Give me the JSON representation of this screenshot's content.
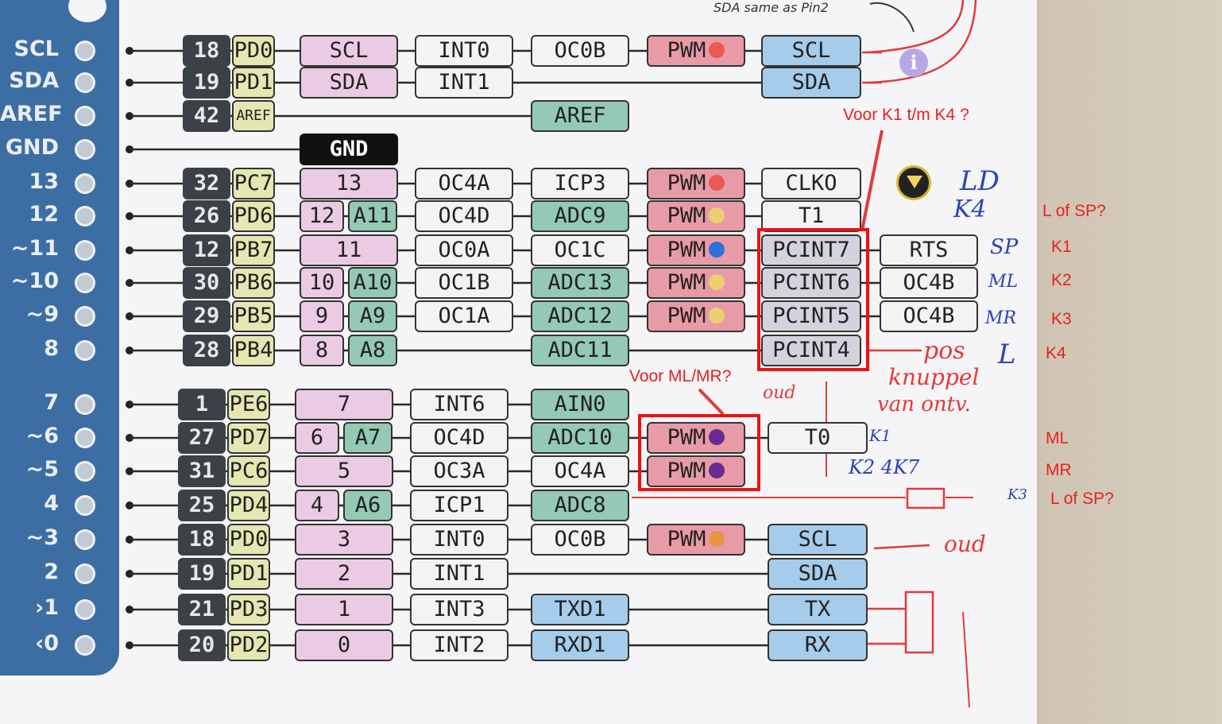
{
  "top_note": "SDA same as Pin2",
  "side_labels": [
    "SCL",
    "SDA",
    "AREF",
    "GND",
    "13",
    "12",
    "~11",
    "~10",
    "~9",
    "8",
    "7",
    "~6",
    "~5",
    "4",
    "~3",
    "2",
    "›1",
    "‹0"
  ],
  "rows": [
    {
      "num": "18",
      "port": "PD0",
      "c1": "SCL",
      "f1": "INT0",
      "f2": "OC0B",
      "pwm": "PWM",
      "dot": "#e85a52",
      "f4": "SCL"
    },
    {
      "num": "19",
      "port": "PD1",
      "c1": "SDA",
      "f1": "INT1",
      "f4": "SDA"
    },
    {
      "num": "42",
      "port": "AREF",
      "f2": "AREF"
    },
    {
      "gnd": "GND"
    },
    {
      "num": "32",
      "port": "PC7",
      "c1": "13",
      "f1": "OC4A",
      "f2": "ICP3",
      "pwm": "PWM",
      "dot": "#e85a52",
      "f4": "CLKO"
    },
    {
      "num": "26",
      "port": "PD6",
      "c1": "12",
      "a": "A11",
      "f1": "OC4D",
      "f2": "ADC9",
      "pwm": "PWM",
      "dot": "#eccf73",
      "f4": "T1"
    },
    {
      "num": "12",
      "port": "PB7",
      "c1": "11",
      "f1": "OC0A",
      "f2": "OC1C",
      "pwm": "PWM",
      "dot": "#2f6fd8",
      "f4": "PCINT7",
      "f5": "RTS"
    },
    {
      "num": "30",
      "port": "PB6",
      "c1": "10",
      "a": "A10",
      "f1": "OC1B",
      "f2": "ADC13",
      "pwm": "PWM",
      "dot": "#eccf73",
      "f4": "PCINT6",
      "f5": "OC4B"
    },
    {
      "num": "29",
      "port": "PB5",
      "c1": "9",
      "a": "A9",
      "f1": "OC1A",
      "f2": "ADC12",
      "pwm": "PWM",
      "dot": "#eccf73",
      "f4": "PCINT5",
      "f5": "OC4B"
    },
    {
      "num": "28",
      "port": "PB4",
      "c1": "8",
      "a": "A8",
      "f2": "ADC11",
      "f4": "PCINT4"
    },
    {
      "num": "1",
      "port": "PE6",
      "c1": "7",
      "f1": "INT6",
      "f2": "AIN0"
    },
    {
      "num": "27",
      "port": "PD7",
      "c1": "6",
      "a": "A7",
      "f1": "OC4D",
      "f2": "ADC10",
      "pwm": "PWM",
      "dot": "#6b2a8f",
      "f4": "T0"
    },
    {
      "num": "31",
      "port": "PC6",
      "c1": "5",
      "f1": "OC3A",
      "f2": "OC4A",
      "pwm": "PWM",
      "dot": "#6b2a8f"
    },
    {
      "num": "25",
      "port": "PD4",
      "c1": "4",
      "a": "A6",
      "f1": "ICP1",
      "f2": "ADC8"
    },
    {
      "num": "18",
      "port": "PD0",
      "c1": "3",
      "f1": "INT0",
      "f2": "OC0B",
      "pwm": "PWM",
      "dot": "#e89444",
      "f4": "SCL"
    },
    {
      "num": "19",
      "port": "PD1",
      "c1": "2",
      "f1": "INT1",
      "f4": "SDA"
    },
    {
      "num": "21",
      "port": "PD3",
      "c1": "1",
      "f1": "INT3",
      "f2": "TXD1",
      "f4": "TX"
    },
    {
      "num": "20",
      "port": "PD2",
      "c1": "0",
      "f1": "INT2",
      "f2": "RXD1",
      "f4": "RX"
    }
  ],
  "annotations": {
    "voor_k1_k4": "Voor K1 t/m K4 ?",
    "voor_ml_mr": "Voor ML/MR?",
    "right": [
      "L of SP?",
      "K1",
      "K2",
      "K3",
      "K4",
      "ML",
      "MR",
      "L of SP?"
    ]
  },
  "handwriting": {
    "ld": "LD",
    "k4": "K4",
    "sp": "SP",
    "ml": "ML",
    "mr": "MR",
    "l": "L",
    "k1": "K1",
    "k2_4k7": "K2 4K7",
    "k3": "K3",
    "pos": "pos",
    "knuppel": "knuppel",
    "van_ontv": "van ontv.",
    "oud": "oud",
    "oud2": "oud"
  },
  "colors": {
    "annotation_red": "#e8221f",
    "board_blue": "#3d6ea3",
    "pen_blue": "#2c43b5"
  }
}
